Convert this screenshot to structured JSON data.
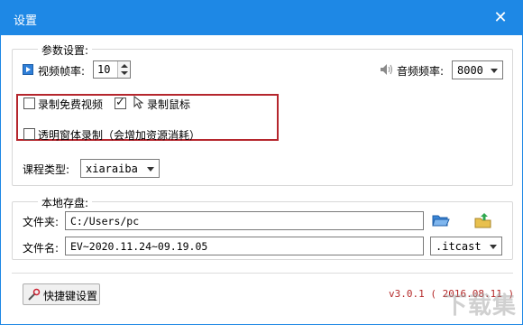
{
  "window": {
    "title": "设置",
    "close_glyph": "✕"
  },
  "params": {
    "legend": "参数设置:",
    "video_fps_label": "视频帧率:",
    "video_fps_value": "10",
    "audio_rate_label": "音频频率:",
    "audio_rate_value": "8000",
    "record_free_video_label": "录制免费视频",
    "record_free_video_checked": false,
    "record_mouse_label": "录制鼠标",
    "record_mouse_checked": true,
    "transparent_record_label": "透明窗体录制（会增加资源消耗）",
    "transparent_record_checked": false,
    "course_type_label": "课程类型:",
    "course_type_value": "xiaraiba"
  },
  "storage": {
    "legend": "本地存盘:",
    "folder_label": "文件夹:",
    "folder_value": "C:/Users/pc",
    "filename_label": "文件名:",
    "filename_value": "EV~2020.11.24~09.19.05",
    "extension_value": ".itcast"
  },
  "footer": {
    "hotkey_button_label": "快捷键设置",
    "version_text": "v3.0.1 ( 2016.08.11 )"
  },
  "icons": {
    "video": "video-icon",
    "speaker": "speaker-icon",
    "cursor": "cursor-icon",
    "open_folder": "open-folder-icon",
    "upload_folder": "folder-up-icon",
    "hotkey": "hotkey-icon"
  },
  "colors": {
    "titlebar": "#1e88e5",
    "highlight_box": "#b5262d",
    "version_text": "#b52a2a"
  },
  "watermark": "下载集"
}
